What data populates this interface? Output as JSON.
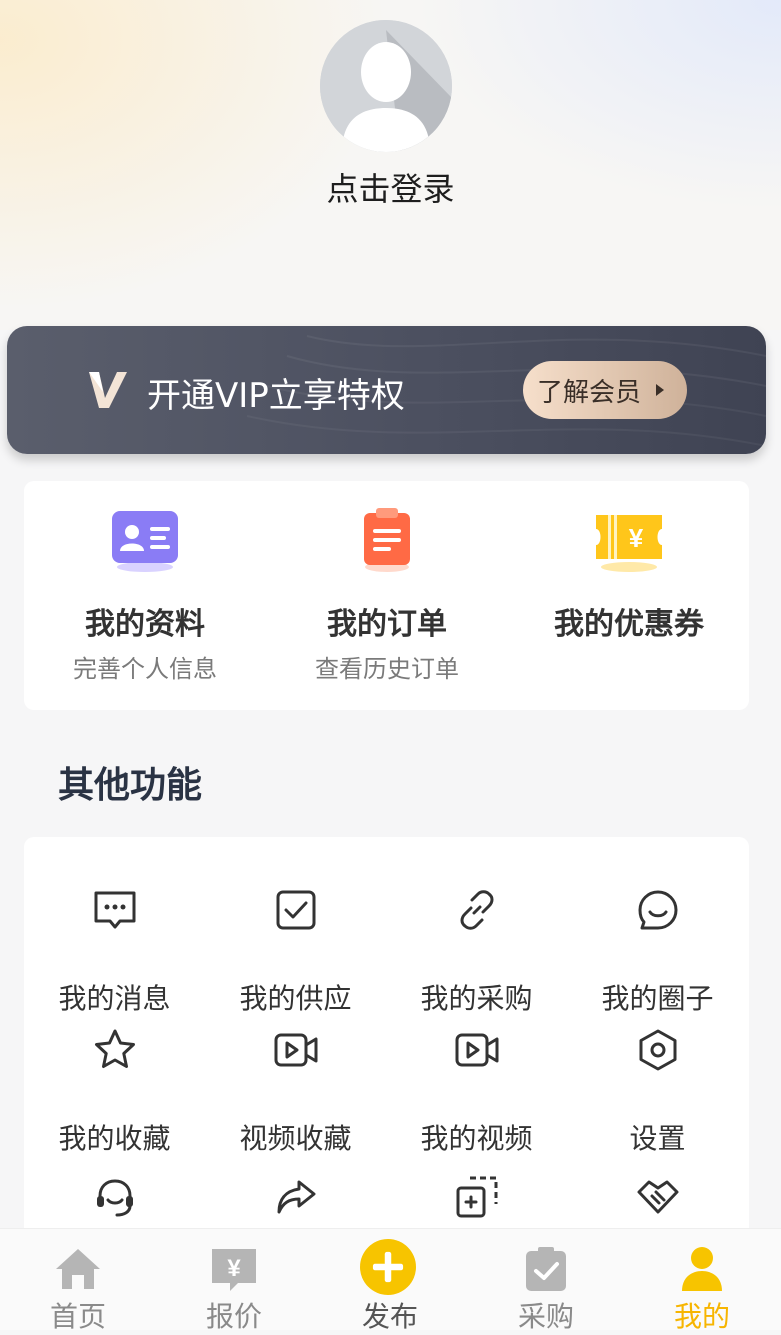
{
  "header": {
    "login_label": "点击登录"
  },
  "vip_banner": {
    "text": "开通VIP立享特权",
    "button_label": "了解会员"
  },
  "quick_actions": [
    {
      "title": "我的资料",
      "subtitle": "完善个人信息",
      "icon": "profile-card-icon"
    },
    {
      "title": "我的订单",
      "subtitle": "查看历史订单",
      "icon": "order-clipboard-icon"
    },
    {
      "title": "我的优惠券",
      "subtitle": "",
      "icon": "coupon-ticket-icon"
    }
  ],
  "other_features": {
    "title": "其他功能",
    "items": [
      {
        "label": "我的消息",
        "icon": "message-icon"
      },
      {
        "label": "我的供应",
        "icon": "checkbox-icon"
      },
      {
        "label": "我的采购",
        "icon": "link-icon"
      },
      {
        "label": "我的圈子",
        "icon": "smile-chat-icon"
      },
      {
        "label": "我的收藏",
        "icon": "star-icon"
      },
      {
        "label": "视频收藏",
        "icon": "video-icon"
      },
      {
        "label": "我的视频",
        "icon": "video-icon"
      },
      {
        "label": "设置",
        "icon": "settings-hexagon-icon"
      },
      {
        "label": "",
        "icon": "headset-icon"
      },
      {
        "label": "",
        "icon": "share-arrow-icon"
      },
      {
        "label": "",
        "icon": "copy-icon"
      },
      {
        "label": "",
        "icon": "handshake-icon"
      }
    ]
  },
  "tabbar": {
    "active": "我的",
    "items": [
      {
        "label": "首页",
        "icon": "home-icon"
      },
      {
        "label": "报价",
        "icon": "price-tag-icon"
      },
      {
        "label": "发布",
        "icon": "plus-circle-icon"
      },
      {
        "label": "采购",
        "icon": "clipboard-check-icon"
      },
      {
        "label": "我的",
        "icon": "user-icon"
      }
    ]
  },
  "colors": {
    "accent": "#f7b500",
    "vip_bg": "#4c5060",
    "text_dark": "#333333"
  }
}
